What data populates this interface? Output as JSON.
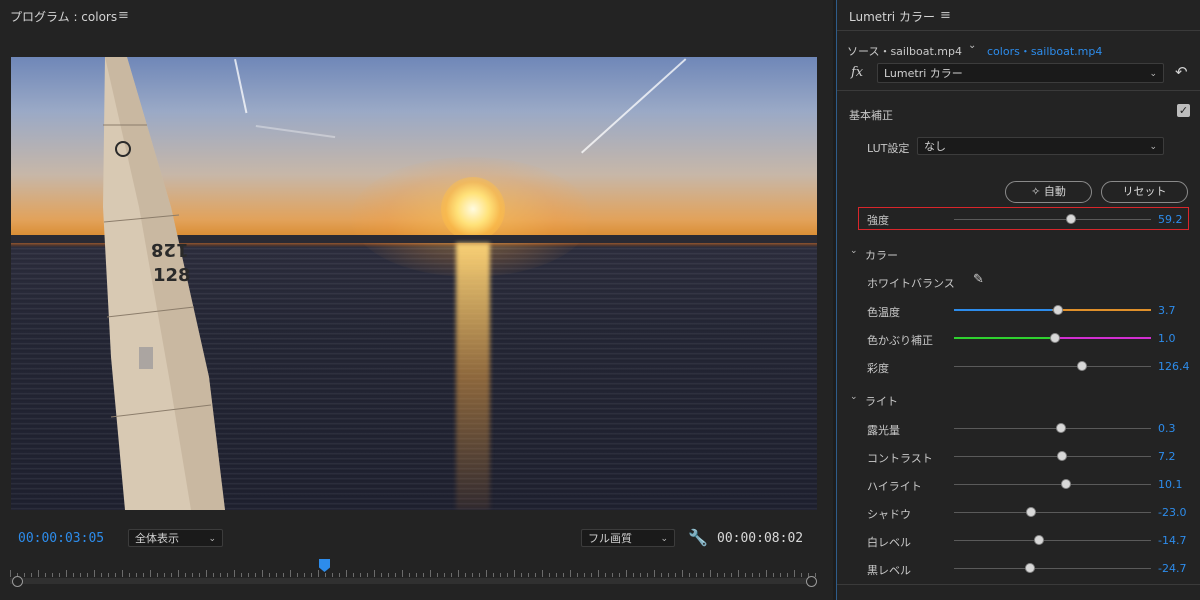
{
  "program": {
    "title": "プログラム : colors",
    "current_timecode": "00:00:03:05",
    "zoom": "全体表示",
    "resolution": "フル画質",
    "duration_timecode": "00:00:08:02"
  },
  "lumetri": {
    "title": "Lumetri カラー",
    "source_label": "ソース・sailboat.mp4",
    "target_label": "colors・sailboat.mp4",
    "fx_label": "fx",
    "effect_select": "Lumetri カラー",
    "basic_section": "基本補正",
    "lut_label": "LUT設定",
    "lut_value": "なし",
    "auto_button": "自動",
    "reset_button": "リセット",
    "intensity": {
      "label": "強度",
      "value": "59.2"
    },
    "color_section": "カラー",
    "white_balance": "ホワイトバランス",
    "color_sliders": [
      {
        "label": "色温度",
        "value": "3.7"
      },
      {
        "label": "色かぶり補正",
        "value": "1.0"
      },
      {
        "label": "彩度",
        "value": "126.4"
      }
    ],
    "light_section": "ライト",
    "light_sliders": [
      {
        "label": "露光量",
        "value": "0.3"
      },
      {
        "label": "コントラスト",
        "value": "7.2"
      },
      {
        "label": "ハイライト",
        "value": "10.1"
      },
      {
        "label": "シャドウ",
        "value": "-23.0"
      },
      {
        "label": "白レベル",
        "value": "-14.7"
      },
      {
        "label": "黒レベル",
        "value": "-24.7"
      }
    ]
  },
  "colors": {
    "accent": "#2d8ceb",
    "highlight_box": "#d9262b"
  }
}
